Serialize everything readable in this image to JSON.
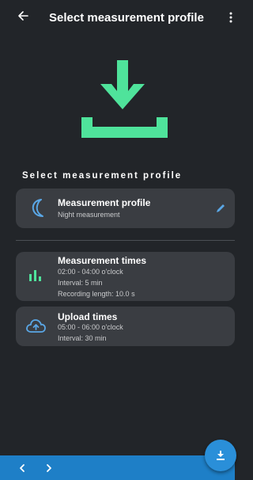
{
  "header": {
    "title": "Select measurement profile"
  },
  "section": {
    "title": "Select measurement profile"
  },
  "profile_card": {
    "title": "Measurement profile",
    "subtitle": "Night measurement"
  },
  "measurement_times_card": {
    "title": "Measurement times",
    "lines": [
      "02:00 - 04:00 o'clock",
      "Interval: 5 min",
      "Recording length: 10.0 s"
    ]
  },
  "upload_times_card": {
    "title": "Upload times",
    "lines": [
      "05:00 - 06:00 o'clock",
      "Interval: 30 min"
    ]
  },
  "icons": {
    "back": "arrow-left-icon",
    "overflow": "more-vertical-icon",
    "hero": "download-icon",
    "profile": "moon-icon",
    "times": "bar-chart-icon",
    "upload": "cloud-upload-icon",
    "edit": "pencil-icon",
    "prev": "chevron-left-icon",
    "next": "chevron-right-icon",
    "fab": "download-icon"
  },
  "colors": {
    "background": "#222529",
    "card": "#3a3d42",
    "accent_green": "#4fe39b",
    "accent_blue": "#2a8fd9",
    "icon_blue": "#5aa7e6",
    "bottom_bar": "#1e7fc7"
  }
}
